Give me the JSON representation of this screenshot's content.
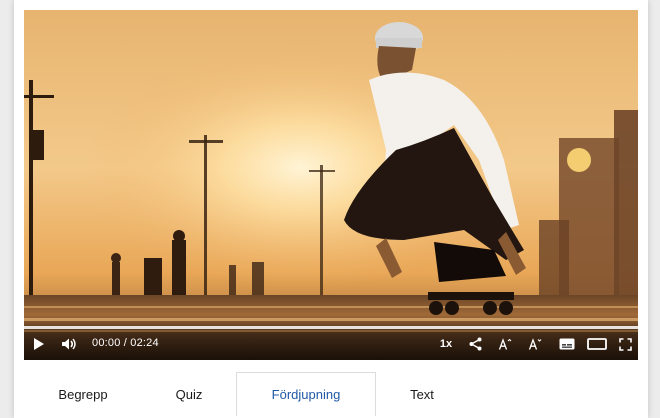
{
  "player": {
    "time_display": "00:00 / 02:24",
    "speed_label": "1x",
    "progress": 0.0,
    "icons": [
      "play-icon",
      "volume-icon",
      "share-icon",
      "font-increase-icon",
      "font-decrease-icon",
      "subtitles-icon",
      "theater-mode-icon",
      "fullscreen-icon"
    ]
  },
  "tabs": [
    {
      "label": "Begrepp",
      "active": false
    },
    {
      "label": "Quiz",
      "active": false
    },
    {
      "label": "Fördjupning",
      "active": true
    },
    {
      "label": "Text",
      "active": false
    }
  ],
  "colors": {
    "active_tab_text": "#1f5aa6",
    "tab_border": "#dcdcdc"
  }
}
